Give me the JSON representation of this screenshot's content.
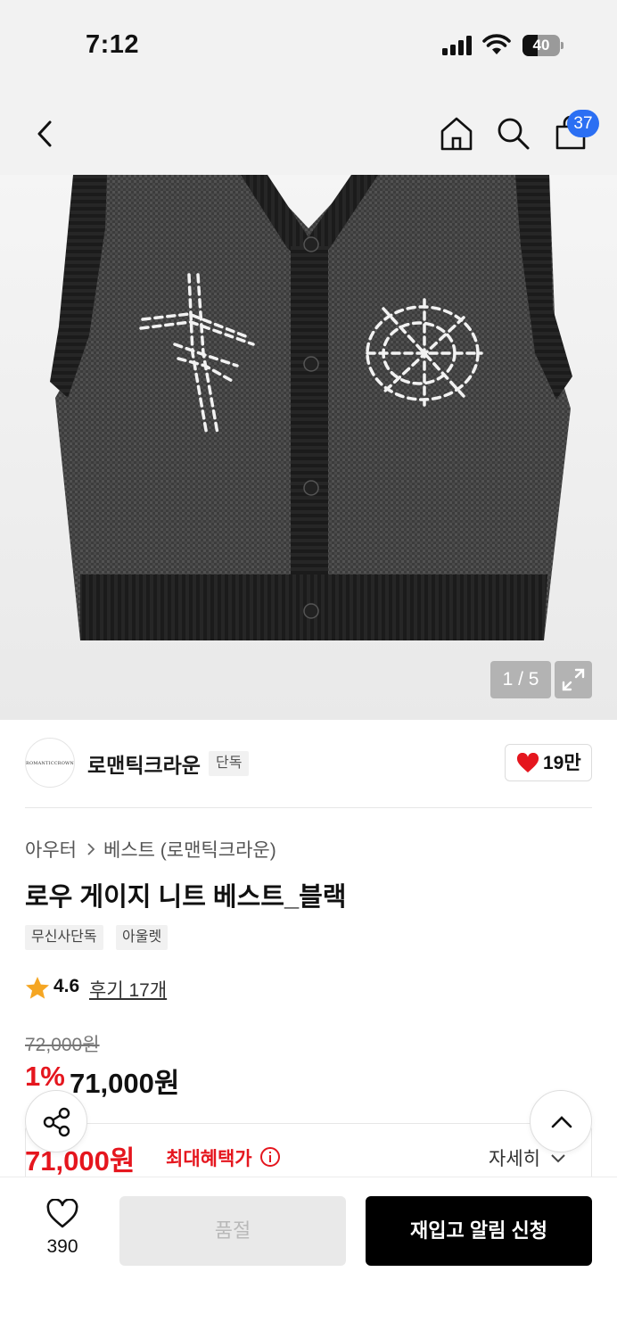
{
  "status_bar": {
    "time": "7:12",
    "battery": "40"
  },
  "nav": {
    "cart_count": "37"
  },
  "gallery": {
    "counter": "1 / 5"
  },
  "brand": {
    "logo_text": "ROMANTICCROWN",
    "name": "로맨틱크라운",
    "tag": "단독",
    "likes": "19만"
  },
  "breadcrumb": {
    "category": "아우터",
    "sub": "베스트 (로맨틱크라운)"
  },
  "product": {
    "title": "로우 게이지 니트 베스트_블랙",
    "chips": [
      "무신사단독",
      "아울렛"
    ],
    "rating": "4.6",
    "reviews": "후기 17개",
    "original_price": "72,000원",
    "discount": "1%",
    "price": "71,000원"
  },
  "benefit": {
    "price": "71,000원",
    "label": "최대혜택가",
    "detail": "자세히"
  },
  "bottom_bar": {
    "wish_count": "390",
    "soldout_label": "품절",
    "restock_label": "재입고 알림 신청"
  },
  "colors": {
    "accent_red": "#e5161e",
    "badge_blue": "#2b6ff3",
    "cta_black": "#000000"
  }
}
